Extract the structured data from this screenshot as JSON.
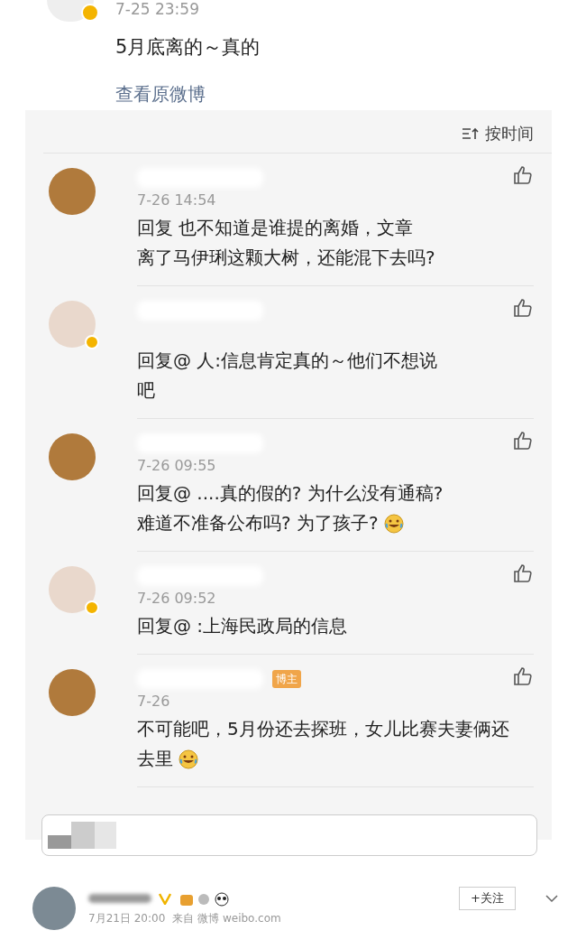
{
  "post": {
    "time": "7-25 23:59",
    "text": "5月底离的～真的",
    "link": "查看原微博"
  },
  "sort": {
    "label": "按时间"
  },
  "comments": [
    {
      "verified": false,
      "time": "7-26 14:54",
      "lines": [
        "回复 也不知道是谁提的离婚，文章",
        "离了马伊琍这颗大树，还能混下去吗?"
      ],
      "emoji": false
    },
    {
      "verified": true,
      "lines": [
        "回复@ 人:信息肯定真的～他们不想说",
        "吧"
      ],
      "emoji": false
    },
    {
      "verified": false,
      "time": "7-26 09:55",
      "lines": [
        "回复@ ....真的假的? 为什么没有通稿?",
        "难道不准备公布吗? 为了孩子?"
      ],
      "emoji": true
    },
    {
      "verified": true,
      "time": "7-26 09:52",
      "lines": [
        "回复@ :上海民政局的信息"
      ],
      "emoji": false
    },
    {
      "verified": false,
      "badge": "博主",
      "time": "7-26",
      "lines": [
        "不可能吧，5月份还去探班，女儿比赛夫妻俩还",
        "去里"
      ],
      "emoji": true
    }
  ],
  "next_post": {
    "time": "7月21日 20:00",
    "source": "来自 微博 weibo.com",
    "follow": "+关注"
  }
}
